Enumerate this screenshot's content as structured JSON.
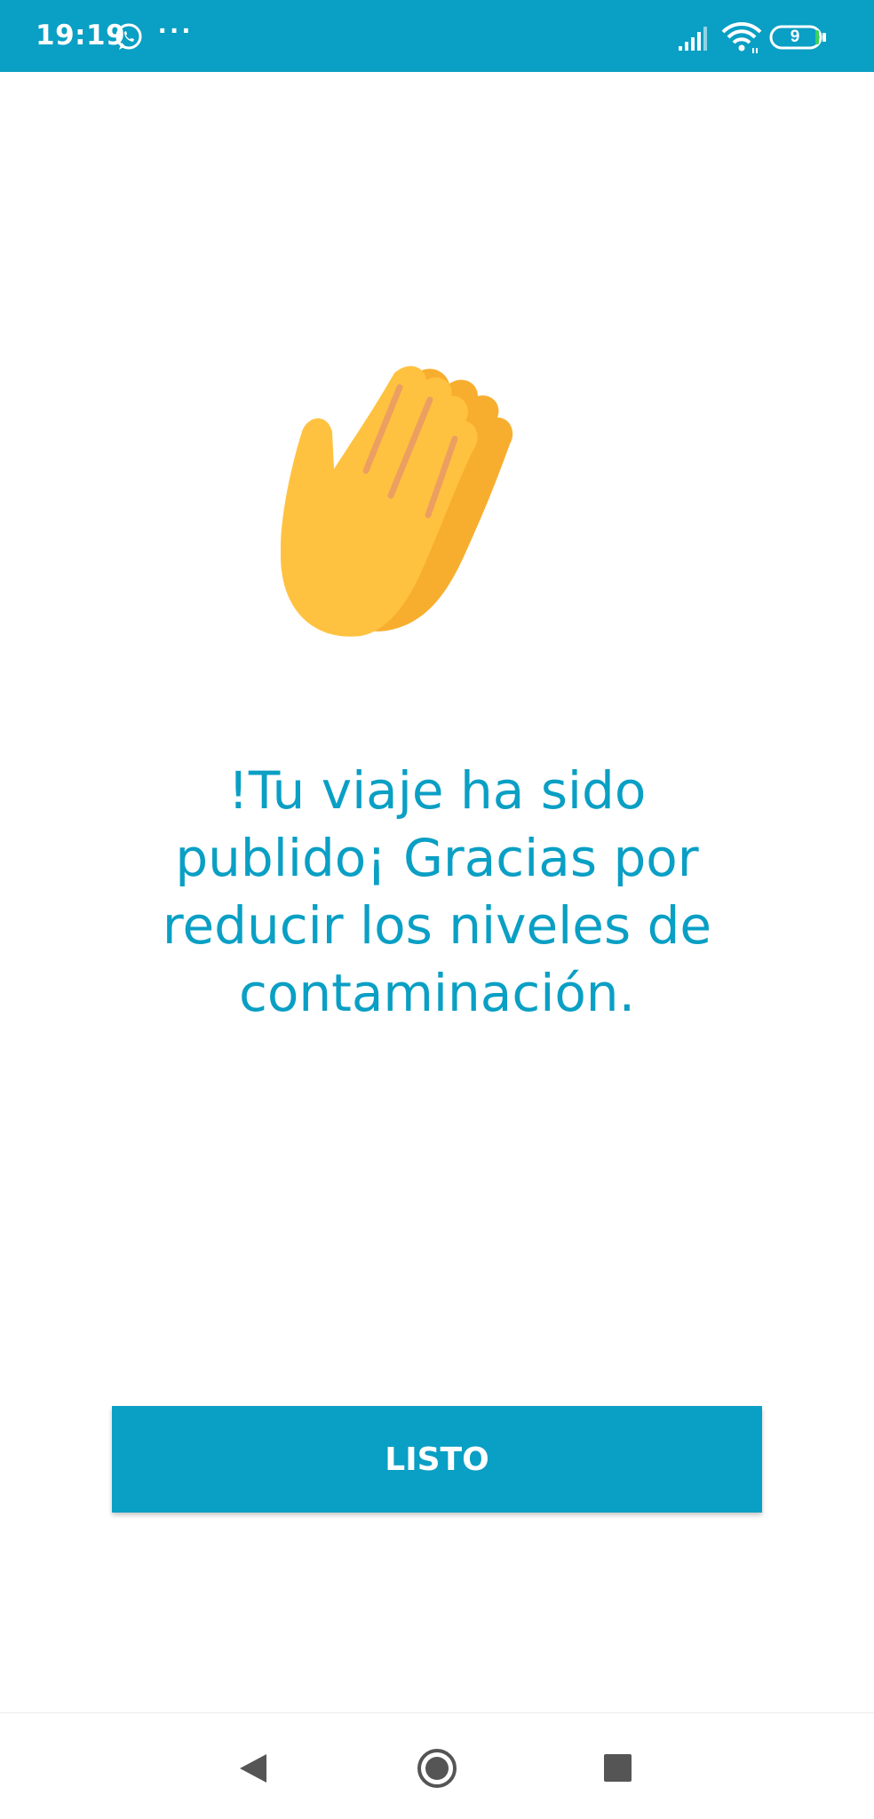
{
  "status_bar": {
    "time": "19:19",
    "notification_icons": [
      "whatsapp-icon"
    ],
    "overflow": "···",
    "battery_level": "9",
    "background_color": "#0a9fc4"
  },
  "main": {
    "icon": "clapping-hands-icon",
    "message": "!Tu viaje ha sido publido¡ Gracias por reducir los niveles de contaminación.",
    "accent_color": "#0a9fc4"
  },
  "actions": {
    "done_label": "LISTO"
  },
  "nav_bar": {
    "icons": [
      "back-icon",
      "home-icon",
      "recents-icon"
    ]
  }
}
